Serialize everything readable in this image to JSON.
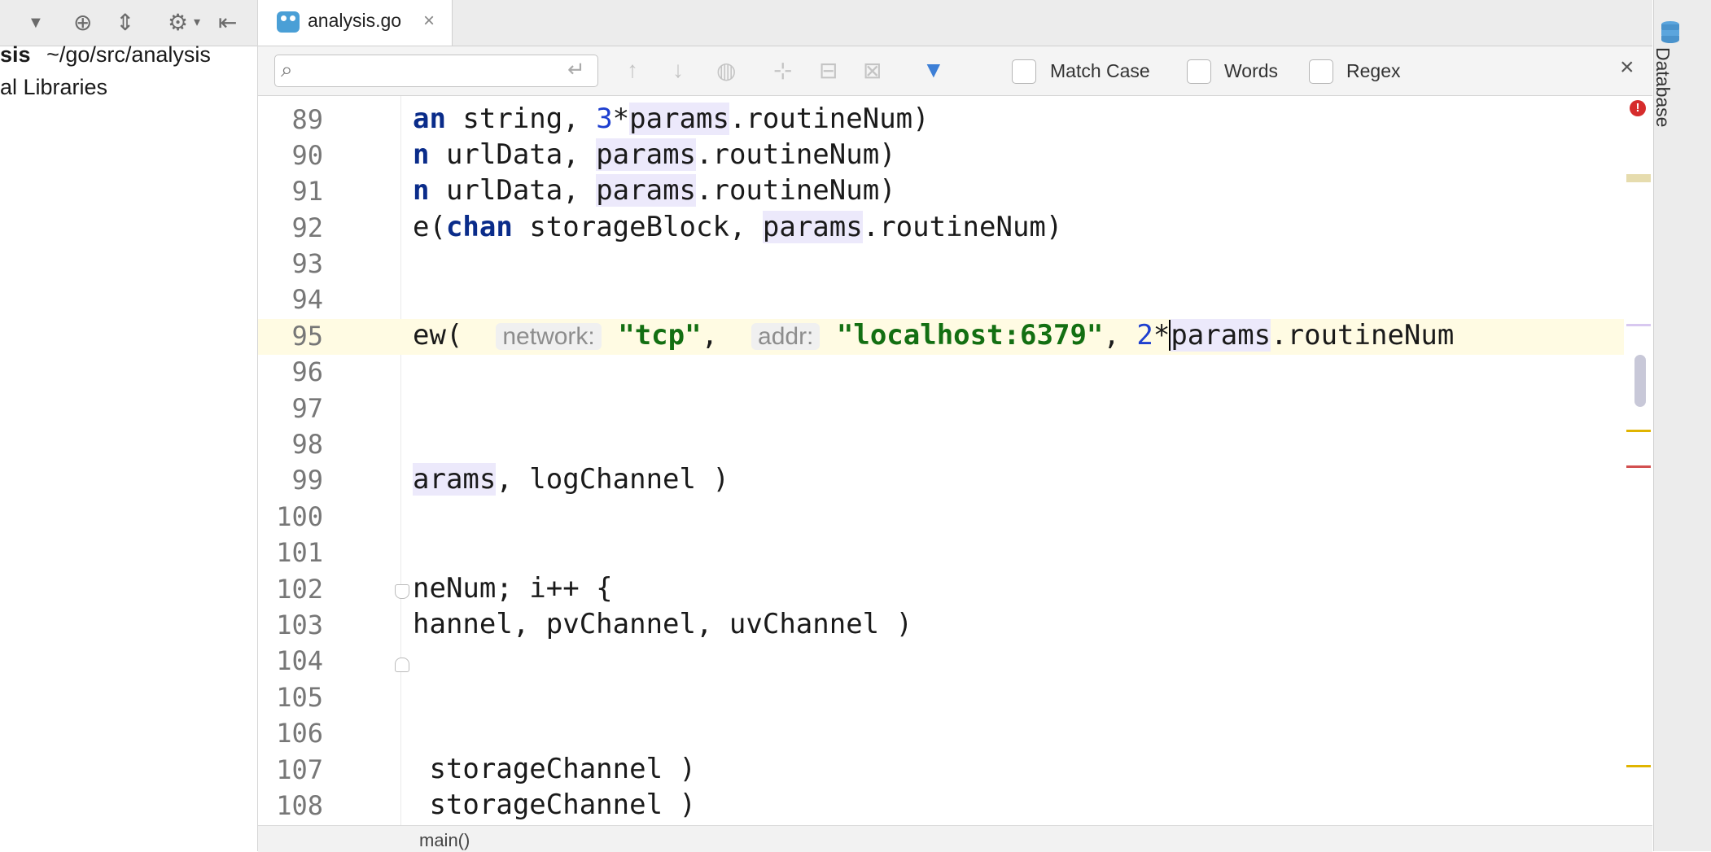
{
  "project": {
    "root_name": "sis",
    "root_path": "~/go/src/analysis",
    "external": "al Libraries"
  },
  "tab": {
    "label": "analysis.go",
    "close": "×"
  },
  "find": {
    "placeholder": "",
    "match_case": "Match Case",
    "words": "Words",
    "regex": "Regex",
    "close": "×"
  },
  "editor": {
    "line_numbers": [
      "89",
      "90",
      "91",
      "92",
      "93",
      "94",
      "95",
      "96",
      "97",
      "98",
      "99",
      "100",
      "101",
      "102",
      "103",
      "104",
      "105",
      "106",
      "107",
      "108"
    ],
    "lines": {
      "l89": {
        "kw": "an",
        "rest1": " string, ",
        "num": "3",
        "rest2": "*",
        "hl": "params",
        "rest3": ".routineNum)"
      },
      "l90": {
        "kw": "n",
        "rest1": " urlData, ",
        "hl": "params",
        "rest2": ".routineNum)"
      },
      "l91": {
        "kw": "n",
        "rest1": " urlData, ",
        "hl": "params",
        "rest2": ".routineNum)"
      },
      "l92": {
        "pre": "e(",
        "kw": "chan",
        "rest1": " storageBlock, ",
        "hl": "params",
        "rest2": ".routineNum)"
      },
      "l95": {
        "pre": "ew(  ",
        "hint1": "network:",
        "str1": "\"tcp\"",
        "sep": ",  ",
        "hint2": "addr:",
        "str2": "\"localhost:6379\"",
        "rest1": ", ",
        "num": "2",
        "rest2": "*",
        "hl": "params",
        "rest3": ".routineNum"
      },
      "l99": {
        "hl": "arams",
        "rest": ", logChannel )"
      },
      "l102": {
        "text": "neNum; i++ {"
      },
      "l103": {
        "text": "hannel, pvChannel, uvChannel )"
      },
      "l107": {
        "text": " storageChannel )"
      },
      "l108": {
        "text": " storageChannel )"
      }
    }
  },
  "breadcrumb": "main()",
  "right_tool": {
    "label": "Database"
  },
  "colors": {
    "keyword": "#0a2c8a",
    "string": "#136f12",
    "number": "#1e3fcf",
    "usage_highlight": "#ece9fb",
    "caret_row": "#fffbe3",
    "error": "#d62c2c",
    "warning_mark": "#e0b400"
  }
}
